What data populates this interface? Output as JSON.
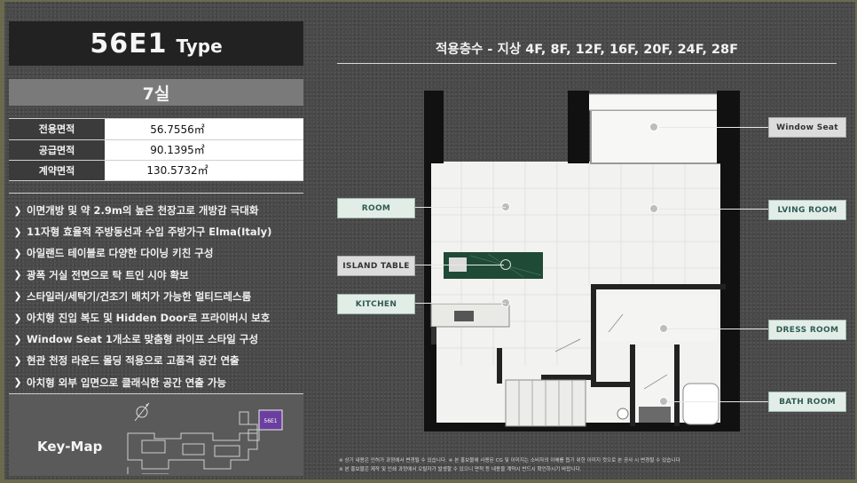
{
  "header": {
    "type_code": "56E1",
    "type_word": "Type"
  },
  "room_count": "7실",
  "areas": [
    {
      "label": "전용면적",
      "value": "56.7556㎡"
    },
    {
      "label": "공급면적",
      "value": "90.1395㎡"
    },
    {
      "label": "계약면적",
      "value": "130.5732㎡"
    }
  ],
  "features": [
    "이면개방 및 약 2.9m의 높은 천장고로 개방감 극대화",
    "11자형 효율적 주방동선과 수입 주방가구 Elma(Italy)",
    "아일랜드 테이블로 다양한 다이닝 키친 구성",
    "광폭 거실 전면으로 탁 트인 시야 확보",
    "스타일러/세탁기/건조기 배치가 가능한 멀티드레스룸",
    "아치형 진입 복도 및 Hidden Door로 프라이버시 보호",
    "Window Seat 1개소로 맞춤형 라이프 스타일 구성",
    "현관 천정 라운드 몰딩 적용으로 고품격 공간 연출",
    "아치형 외부 입면으로 클래식한 공간 연출 가능"
  ],
  "keymap": {
    "label": "Key-Map",
    "unit_tag": "56E1"
  },
  "floors": "적용층수 - 지상 4F, 8F, 12F, 16F, 20F, 24F, 28F",
  "callouts": {
    "window_seat": "Window Seat",
    "room": "ROOM",
    "living_room": "LVING ROOM",
    "island_table": "ISLAND TABLE",
    "kitchen": "KITCHEN",
    "dress_room": "DRESS ROOM",
    "bath_room": "BATH ROOM"
  },
  "notes": [
    "※ 상기 내용은 인허가 과정에서 변경될 수 있습니다. ※ 본 홍보물에 사용된 CG 및 이미지는 소비자의 이해를 돕기 위한 이미지 컷으로 본 공사 시 변경될 수 있습니다",
    "※ 본 홍보물은 제작 및 인쇄 과정에서 오탈자가 발생할 수 있으니 면적 등 내용을 계약시 반드시 확인하시기 바랍니다."
  ],
  "colors": {
    "callout_teal": "#e3ede8",
    "callout_gray": "#dcdcdc",
    "island_marble": "#1f4a35",
    "keymap_unit": "#6b3fa0"
  }
}
